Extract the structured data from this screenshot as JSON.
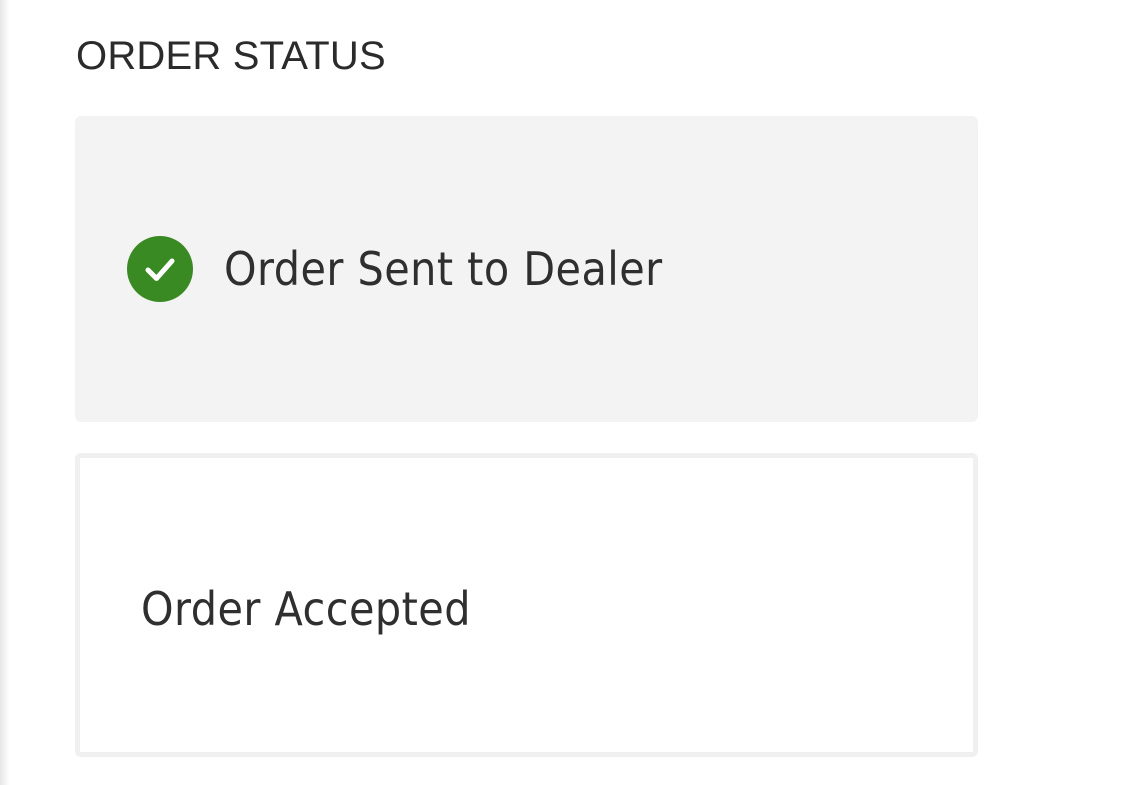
{
  "order_status": {
    "title": "ORDER STATUS",
    "steps": [
      {
        "label": "Order Sent to Dealer",
        "state": "completed",
        "icon": "check-circle-icon",
        "icon_color": "#3a8a24"
      },
      {
        "label": "Order Accepted",
        "state": "pending"
      }
    ]
  },
  "colors": {
    "completed_card_bg": "#f3f3f3",
    "pending_card_border": "#f0f0f0",
    "text": "#2f2f2f"
  }
}
